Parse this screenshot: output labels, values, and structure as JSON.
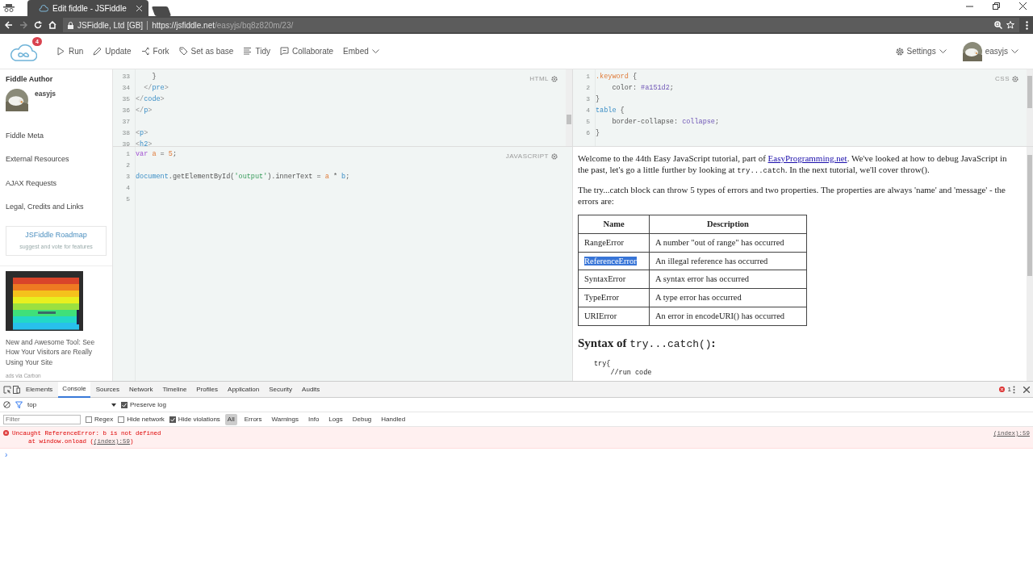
{
  "browser": {
    "tab_title": "Edit fiddle - JSFiddle",
    "site_identity": "JSFiddle, Ltd [GB]",
    "url_host": "https://jsfiddle.net",
    "url_path": "/easyjs/bq8z820m/23/"
  },
  "toolbar": {
    "notification_count": "4",
    "actions": [
      {
        "label": "Run",
        "kind": "run",
        "has_menu": false
      },
      {
        "label": "Update",
        "kind": "update",
        "has_menu": false
      },
      {
        "label": "Fork",
        "kind": "fork",
        "has_menu": false
      },
      {
        "label": "Set as base",
        "kind": "base",
        "has_menu": false
      },
      {
        "label": "Tidy",
        "kind": "tidy",
        "has_menu": false
      },
      {
        "label": "Collaborate",
        "kind": "collaborate",
        "has_menu": false
      },
      {
        "label": "Embed",
        "kind": "embed",
        "has_menu": true
      }
    ],
    "settings": "Settings",
    "user": "easyjs"
  },
  "sidebar": {
    "author_heading": "Fiddle Author",
    "author_name": "easyjs",
    "links": [
      "Fiddle Meta",
      "External Resources",
      "AJAX Requests",
      "Legal, Credits and Links"
    ],
    "roadmap": {
      "title": "JSFiddle Roadmap",
      "subtitle": "suggest and vote for features"
    },
    "ad": {
      "kind": "picture",
      "text": "New and Awesome Tool: See How Your Visitors are Really Using Your Site",
      "via": "ads via Carbon"
    }
  },
  "html_editor": {
    "label": "HTML",
    "lines": [
      {
        "number": "33",
        "tokens": [
          {
            "text": "    }",
            "kind": "plain"
          }
        ]
      },
      {
        "number": "34",
        "tokens": [
          {
            "text": "  </",
            "kind": "bracket"
          },
          {
            "text": "pre",
            "kind": "tag"
          },
          {
            "text": ">",
            "kind": "bracket"
          }
        ]
      },
      {
        "number": "35",
        "tokens": [
          {
            "text": "</",
            "kind": "bracket"
          },
          {
            "text": "code",
            "kind": "tag"
          },
          {
            "text": ">",
            "kind": "bracket"
          }
        ]
      },
      {
        "number": "36",
        "tokens": [
          {
            "text": "</",
            "kind": "bracket"
          },
          {
            "text": "p",
            "kind": "tag"
          },
          {
            "text": ">",
            "kind": "bracket"
          }
        ]
      },
      {
        "number": "37"
      },
      {
        "number": "38",
        "tokens": [
          {
            "text": "<",
            "kind": "bracket"
          },
          {
            "text": "p",
            "kind": "tag"
          },
          {
            "text": ">",
            "kind": "bracket"
          }
        ]
      },
      {
        "number": "39",
        "tokens": [
          {
            "text": "<",
            "kind": "bracket"
          },
          {
            "text": "h2",
            "kind": "tag"
          },
          {
            "text": ">",
            "kind": "bracket"
          }
        ]
      }
    ]
  },
  "css_editor": {
    "label": "CSS",
    "lines": [
      {
        "number": "1",
        "tokens": [
          {
            "text": ".keyword",
            "kind": "selector"
          },
          {
            "text": " {",
            "kind": "plain"
          }
        ]
      },
      {
        "number": "2",
        "tokens": [
          {
            "text": "    color: ",
            "kind": "plain"
          },
          {
            "text": "#a151d2",
            "kind": "value"
          },
          {
            "text": ";",
            "kind": "plain"
          }
        ]
      },
      {
        "number": "3",
        "tokens": [
          {
            "text": "}",
            "kind": "plain"
          }
        ]
      },
      {
        "number": "4",
        "tokens": [
          {
            "text": "table",
            "kind": "tag"
          },
          {
            "text": " {",
            "kind": "plain"
          }
        ]
      },
      {
        "number": "5",
        "tokens": [
          {
            "text": "    border-collapse: ",
            "kind": "plain"
          },
          {
            "text": "collapse",
            "kind": "value"
          },
          {
            "text": ";",
            "kind": "plain"
          }
        ]
      },
      {
        "number": "6",
        "tokens": [
          {
            "text": "}",
            "kind": "plain"
          }
        ]
      }
    ]
  },
  "js_editor": {
    "label": "JAVASCRIPT",
    "lines": [
      {
        "number": "1",
        "tokens": [
          {
            "text": "var ",
            "kind": "keyword"
          },
          {
            "text": "a",
            "kind": "variable"
          },
          {
            "text": " = ",
            "kind": "plain"
          },
          {
            "text": "5",
            "kind": "number"
          },
          {
            "text": ";",
            "kind": "plain"
          }
        ]
      },
      {
        "number": "2"
      },
      {
        "number": "3",
        "tokens": [
          {
            "text": "document",
            "kind": "tag"
          },
          {
            "text": ".getElementById(",
            "kind": "plain"
          },
          {
            "text": "'output'",
            "kind": "string"
          },
          {
            "text": ").innerText = ",
            "kind": "plain"
          },
          {
            "text": "a",
            "kind": "variable"
          },
          {
            "text": " * ",
            "kind": "plain"
          },
          {
            "text": "b",
            "kind": "tag"
          },
          {
            "text": ";",
            "kind": "plain"
          }
        ]
      },
      {
        "number": "4"
      },
      {
        "number": "5"
      }
    ]
  },
  "result": {
    "paragraphs": [
      {
        "parts": [
          {
            "kind": "text",
            "text": "Welcome to the 44th Easy JavaScript tutorial, part of "
          },
          {
            "kind": "link",
            "text": "EasyProgramming.net"
          },
          {
            "kind": "text",
            "text": ". We've looked at how to debug JavaScript in the past, let's go a little further by looking at "
          },
          {
            "kind": "code",
            "text": "try...catch"
          },
          {
            "kind": "text",
            "text": ". In the next tutorial, we'll cover throw()."
          }
        ]
      },
      {
        "parts": [
          {
            "kind": "text",
            "text": "The try...catch block can throw 5 types of errors and two properties. The properties are always 'name' and 'message' - the errors are:"
          }
        ]
      }
    ],
    "table": {
      "columns": [
        "Name",
        "Description"
      ],
      "rows": [
        {
          "name": "RangeError",
          "description": "A number \"out of range\" has occurred",
          "highlighted": false
        },
        {
          "name": "ReferenceError",
          "description": "An illegal reference has occurred",
          "highlighted": true
        },
        {
          "name": "SyntaxError",
          "description": "A syntax error has occurred",
          "highlighted": false
        },
        {
          "name": "TypeError",
          "description": "A type error has occurred",
          "highlighted": false
        },
        {
          "name": "URIError",
          "description": "An error in encodeURI() has occurred",
          "highlighted": false
        }
      ]
    },
    "heading": {
      "parts": [
        {
          "kind": "text",
          "text": "Syntax of "
        },
        {
          "kind": "code",
          "text": "try...catch()"
        },
        {
          "kind": "text",
          "text": ":"
        }
      ]
    },
    "code_block": [
      "try{",
      "    //run code"
    ]
  },
  "devtools": {
    "tabs": [
      {
        "label": "Elements",
        "selected": false
      },
      {
        "label": "Console",
        "selected": true
      },
      {
        "label": "Sources",
        "selected": false
      },
      {
        "label": "Network",
        "selected": false
      },
      {
        "label": "Timeline",
        "selected": false
      },
      {
        "label": "Profiles",
        "selected": false
      },
      {
        "label": "Application",
        "selected": false
      },
      {
        "label": "Security",
        "selected": false
      },
      {
        "label": "Audits",
        "selected": false
      }
    ],
    "error_count": "1",
    "context": "top",
    "preserve_log": {
      "label": "Preserve log",
      "checked": true
    },
    "filter": {
      "placeholder": "Filter"
    },
    "options": [
      {
        "label": "Regex",
        "checked": false
      },
      {
        "label": "Hide network",
        "checked": false
      },
      {
        "label": "Hide violations",
        "checked": true
      }
    ],
    "levels": [
      {
        "label": "All",
        "selected": true
      },
      {
        "label": "Errors",
        "selected": false
      },
      {
        "label": "Warnings",
        "selected": false
      },
      {
        "label": "Info",
        "selected": false
      },
      {
        "label": "Logs",
        "selected": false
      },
      {
        "label": "Debug",
        "selected": false
      },
      {
        "label": "Handled",
        "selected": false
      }
    ],
    "messages": [
      {
        "kind": "error",
        "text": "Uncaught ReferenceError: b is not defined",
        "stack_prefix": "at window.onload (",
        "stack_link": "(index):59",
        "stack_suffix": ")",
        "source": "(index):59"
      }
    ],
    "prompt": "›"
  }
}
